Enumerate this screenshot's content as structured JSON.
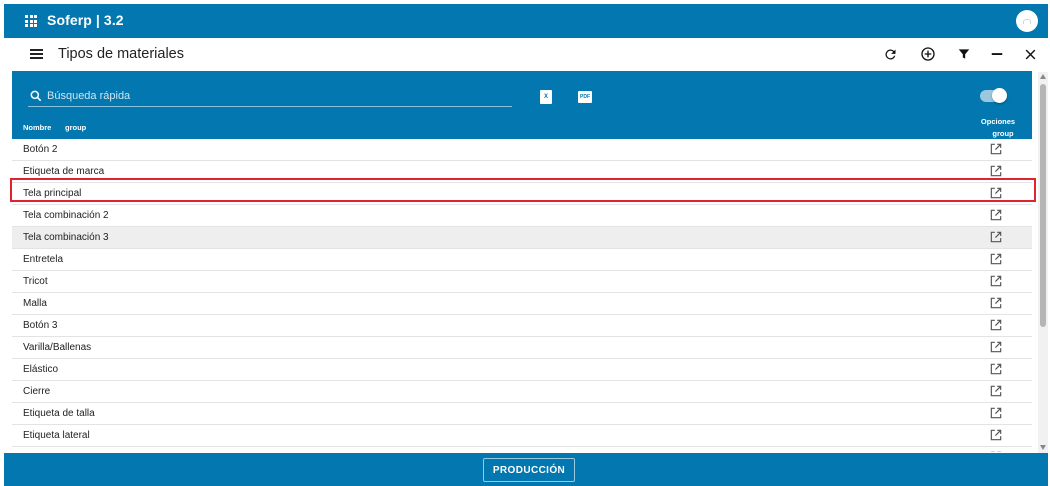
{
  "app": {
    "title": "Soferp | 3.2",
    "icons": [
      "apps-icon",
      "avatar"
    ]
  },
  "toolbar": {
    "title": "Tipos de materiales",
    "icons": [
      "menu-icon",
      "refresh-icon",
      "add-circle-icon",
      "filter-icon",
      "minimize-icon",
      "close-icon"
    ]
  },
  "table": {
    "search_placeholder": "Búsqueda rápida",
    "export_excel_label": "X",
    "export_pdf_label": "PDF",
    "columns": {
      "nombre": "Nombre",
      "group": "group",
      "opciones": "Opciones",
      "opciones_group": "group"
    },
    "rows": [
      "Botón 2",
      "Etiqueta de marca",
      "Tela principal",
      "Tela combinación 2",
      "Tela combinación 3",
      "Entretela",
      "Tricot",
      "Malla",
      "Botón 3",
      "Varilla/Ballenas",
      "Elástico",
      "Cierre",
      "Etiqueta de talla",
      "Etiqueta lateral",
      ""
    ],
    "row_icon": "open-in-new-icon",
    "hovered_row_index": 4,
    "highlighted_row_index": 2
  },
  "footer": {
    "button_label": "PRODUCCIÓN"
  },
  "colors": {
    "primary": "#0277b0",
    "highlight": "#e0242f",
    "row_hover": "#eeeeee"
  }
}
